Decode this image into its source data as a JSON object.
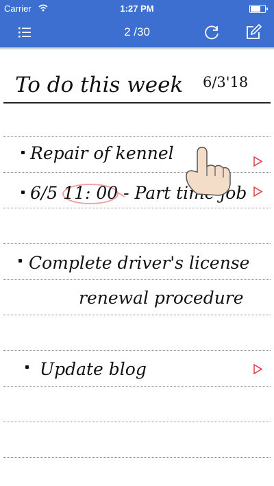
{
  "status_bar": {
    "carrier": "Carrier",
    "time": "1:27 PM"
  },
  "nav_bar": {
    "page_indicator": "2 /30"
  },
  "note": {
    "title": "To do this week",
    "date": "6/3'18",
    "items": [
      {
        "text": "Repair of kennel"
      },
      {
        "text": "6/5 11: 00 - Part time job"
      },
      {
        "text": "Complete driver's license",
        "text_continued": "renewal procedure"
      },
      {
        "text": "Update blog"
      }
    ]
  },
  "colors": {
    "bar": "#3d6fd1",
    "arrow": "#e0303a",
    "highlight": "#f2a3a3",
    "hand_skin": "#f4ddc8"
  }
}
